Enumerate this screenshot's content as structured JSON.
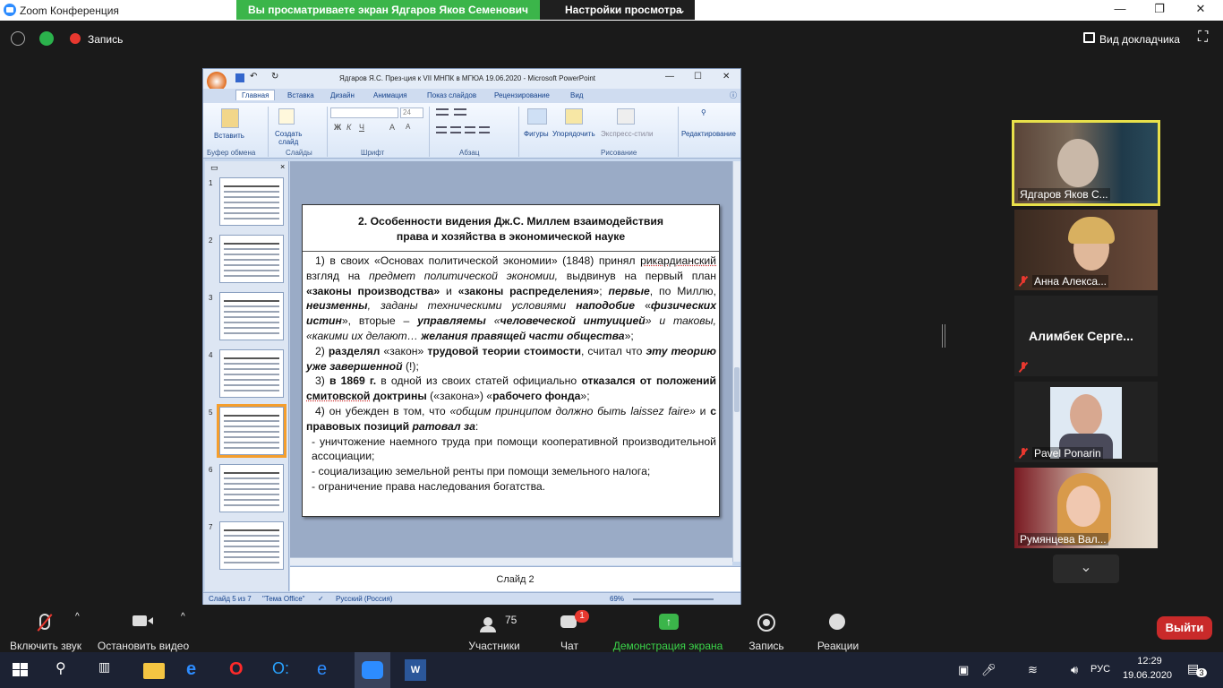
{
  "zoom_window": {
    "title": "Zoom Конференция",
    "minimize": "—",
    "maximize": "❐",
    "close": "✕"
  },
  "share": {
    "banner_text": "Вы просматриваете экран Ядгаров Яков Семенович",
    "view_options": "Настройки просмотра",
    "recording": "Запись",
    "speaker_view": "Вид докладчика"
  },
  "ppt": {
    "window_title": "Ядгаров Я.С. През-ция к VII МНПК в МГЮА  19.06.2020  -  Microsoft PowerPoint",
    "tabs": [
      "Главная",
      "Вставка",
      "Дизайн",
      "Анимация",
      "Показ слайдов",
      "Рецензирование",
      "Вид"
    ],
    "groups": [
      "Буфер обмена",
      "Слайды",
      "Шрифт",
      "Абзац",
      "Рисование"
    ],
    "buttons": {
      "paste": "Вставить",
      "new_slide_1": "Создать",
      "new_slide_2": "слайд",
      "shapes": "Фигуры",
      "arrange": "Упорядочить",
      "quick_styles": "Экспресс-стили",
      "editing": "Редактирование"
    },
    "font_size": "24",
    "thumbnails": [
      "1",
      "2",
      "3",
      "4",
      "5",
      "6",
      "7"
    ],
    "selected_thumbnail": "5",
    "notes_text": "Слайд 2",
    "status": {
      "slide_of": "Слайд 5 из 7",
      "theme": "\"Тема Office\"",
      "language": "Русский (Россия)",
      "zoom": "69%"
    }
  },
  "slide": {
    "title_line1": "2. Особенности видения Дж.С. Миллем взаимодействия",
    "title_line2": "права и хозяйства в экономической науке",
    "p1": {
      "a": "1) в своих «Основах политической экономии» (1848) принял ",
      "b": "рикардианский",
      "c": " взгляд на ",
      "d": "предмет политической экономии,",
      "e": " выдвинув на первый план ",
      "f": "«законы производства»",
      "g": " и ",
      "h": "«законы распределения»",
      "i": "; ",
      "j": "первые",
      "k": ", по Миллю, ",
      "l": "неизменны",
      "m": ", заданы техническими условиями ",
      "n": "наподобие",
      "o": " «",
      "p": "физических истин",
      "q": "», вторые – ",
      "r": "управляемы",
      "s": " «",
      "t": "человеческой интуицией",
      "u": "» и таковы, «какими их делают… ",
      "v": "желания правящей части общества",
      "w": "»;"
    },
    "p2": {
      "a": "2) ",
      "b": "разделял",
      "c": " «закон» ",
      "d": "трудовой теории стоимости",
      "e": ", считал что ",
      "f": "эту теорию уже завершенной",
      "g": " (!);"
    },
    "p3": {
      "a": "3) ",
      "b": "в 1869 г.",
      "c": " в одной из своих статей официально ",
      "d": "отказался от положений ",
      "e": "смитовской",
      "f": " доктрины",
      "g": " («закона») «",
      "h": "рабочего фонда",
      "i": "»;"
    },
    "p4": {
      "a": "4) он убежден в том, что ",
      "b": "«общим принципом должно быть laissez faire»",
      "c": " и ",
      "d": "с правовых позиций ",
      "e": "ратовал за",
      "f": ":"
    },
    "bullets": [
      "- уничтожение наемного труда при помощи кооперативной производительной ассоциации;",
      "- социализацию земельной ренты при помощи земельного налога;",
      "- ограничение права наследования богатства."
    ]
  },
  "gallery": [
    {
      "name": "Ядгаров Яков С...",
      "muted": false,
      "active": true
    },
    {
      "name": "Анна Алекса...",
      "muted": true,
      "active": false
    },
    {
      "name": "Алимбек  Серге...",
      "muted": true,
      "active": false
    },
    {
      "name": "Pavel Ponarin",
      "muted": true,
      "active": false
    },
    {
      "name": "Румянцева Вал...",
      "muted": false,
      "active": false
    }
  ],
  "toolbar": {
    "unmute": "Включить звук",
    "start_video": "Остановить видео",
    "participants": "Участники",
    "participants_count": "75",
    "chat": "Чат",
    "chat_badge": "1",
    "share_screen": "Демонстрация экрана",
    "record": "Запись",
    "reactions": "Реакции",
    "leave": "Выйти"
  },
  "taskbar": {
    "language": "РУС",
    "time": "12:29",
    "date": "19.06.2020",
    "notifications": "3"
  },
  "colors": {
    "zoom_green": "#3bb54a",
    "leave_red": "#c92a2a",
    "active_speaker": "#e8e04a",
    "ppt_accent": "#15428b",
    "thumb_selected": "#f59e2c"
  }
}
